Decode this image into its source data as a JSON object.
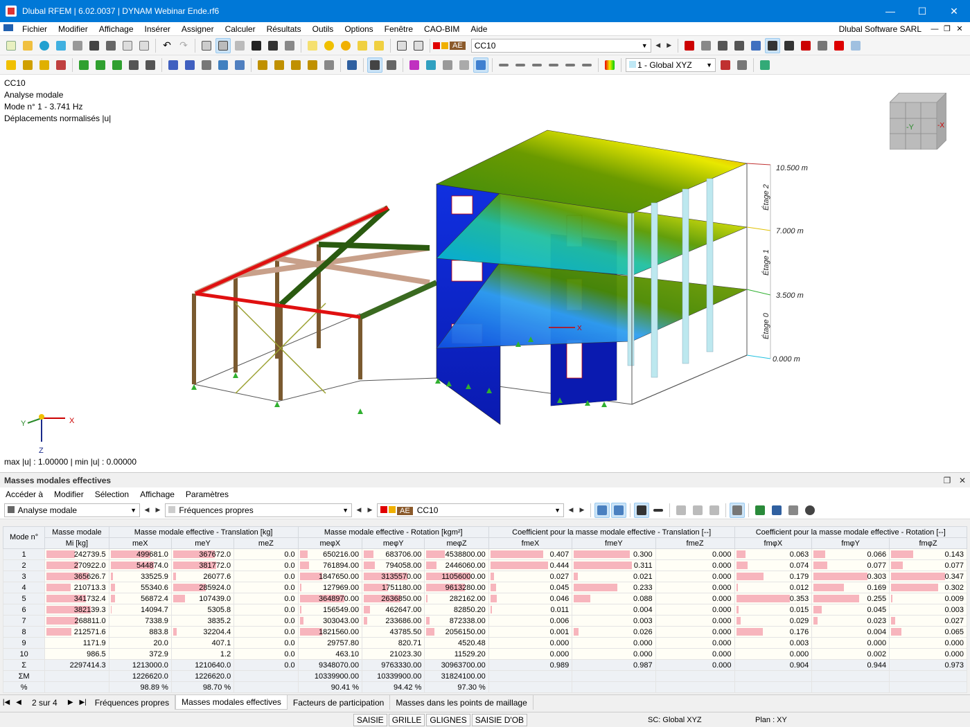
{
  "window": {
    "title": "Dlubal RFEM | 6.02.0037 | DYNAM Webinar Ende.rf6"
  },
  "menu": {
    "items": [
      "Fichier",
      "Modifier",
      "Affichage",
      "Insérer",
      "Assigner",
      "Calculer",
      "Résultats",
      "Outils",
      "Options",
      "Fenêtre",
      "CAO-BIM",
      "Aide"
    ],
    "company": "Dlubal Software SARL"
  },
  "toolbar": {
    "load_tag": "AE",
    "load_case": "CC10",
    "coord_system": "1 - Global XYZ",
    "colors": {
      "swatch1": "#e00000",
      "swatch2": "#f0b000"
    }
  },
  "viewport": {
    "info": [
      "CC10",
      "Analyse modale",
      "Mode n° 1 - 3.741 Hz",
      "Déplacements normalisés |u|"
    ],
    "footer": "max |u| : 1.00000 | min |u| : 0.00000",
    "levels": [
      "10.500 m",
      "7.000 m",
      "3.500 m",
      "0.000 m"
    ],
    "storeys": [
      "Étage 2",
      "Étage 1",
      "Étage 0"
    ],
    "axes": {
      "x": "X",
      "y": "Y",
      "z": "Z"
    },
    "cube": {
      "y": "-Y",
      "x": "-X"
    }
  },
  "panel": {
    "title": "Masses modales effectives",
    "menu": [
      "Accéder à",
      "Modifier",
      "Sélection",
      "Affichage",
      "Paramètres"
    ],
    "combo_analysis": "Analyse modale",
    "combo_type": "Fréquences propres",
    "load_tag": "AE",
    "load_case": "CC10"
  },
  "table": {
    "group_headers": {
      "mode": "Mode n°",
      "mass": "Masse modale",
      "translation": "Masse modale effective - Translation [kg]",
      "rotation": "Masse modale effective - Rotation [kgm²]",
      "coef_translation": "Coefficient pour la masse modale effective - Translation [--]",
      "coef_rotation": "Coefficient pour la masse modale effective - Rotation [--]"
    },
    "columns": [
      "Mi [kg]",
      "meX",
      "meY",
      "meZ",
      "meφX",
      "meφY",
      "meφZ",
      "fmeX",
      "fmeY",
      "fmeZ",
      "fmφX",
      "fmφY",
      "fmφZ"
    ],
    "rows": [
      {
        "mode": "1",
        "vals": [
          "242739.5",
          "499681.0",
          "367672.0",
          "0.0",
          "650216.00",
          "683706.00",
          "4538800.00",
          "0.407",
          "0.300",
          "0.000",
          "0.063",
          "0.066",
          "0.143"
        ]
      },
      {
        "mode": "2",
        "vals": [
          "270922.0",
          "544874.0",
          "381772.0",
          "0.0",
          "761894.00",
          "794058.00",
          "2446060.00",
          "0.444",
          "0.311",
          "0.000",
          "0.074",
          "0.077",
          "0.077"
        ]
      },
      {
        "mode": "3",
        "vals": [
          "365626.7",
          "33525.9",
          "26077.6",
          "0.0",
          "1847650.00",
          "3135570.00",
          "11056000.00",
          "0.027",
          "0.021",
          "0.000",
          "0.179",
          "0.303",
          "0.347"
        ]
      },
      {
        "mode": "4",
        "vals": [
          "210713.3",
          "55340.6",
          "285924.0",
          "0.0",
          "127969.00",
          "1751180.00",
          "9613280.00",
          "0.045",
          "0.233",
          "0.000",
          "0.012",
          "0.169",
          "0.302"
        ]
      },
      {
        "mode": "5",
        "vals": [
          "341732.4",
          "56872.4",
          "107439.0",
          "0.0",
          "3648970.00",
          "2636850.00",
          "282162.00",
          "0.046",
          "0.088",
          "0.000",
          "0.353",
          "0.255",
          "0.009"
        ]
      },
      {
        "mode": "6",
        "vals": [
          "382139.3",
          "14094.7",
          "5305.8",
          "0.0",
          "156549.00",
          "462647.00",
          "82850.20",
          "0.011",
          "0.004",
          "0.000",
          "0.015",
          "0.045",
          "0.003"
        ]
      },
      {
        "mode": "7",
        "vals": [
          "268811.0",
          "7338.9",
          "3835.2",
          "0.0",
          "303043.00",
          "233686.00",
          "872338.00",
          "0.006",
          "0.003",
          "0.000",
          "0.029",
          "0.023",
          "0.027"
        ]
      },
      {
        "mode": "8",
        "vals": [
          "212571.6",
          "883.8",
          "32204.4",
          "0.0",
          "1821560.00",
          "43785.50",
          "2056150.00",
          "0.001",
          "0.026",
          "0.000",
          "0.176",
          "0.004",
          "0.065"
        ]
      },
      {
        "mode": "9",
        "vals": [
          "1171.9",
          "20.0",
          "407.1",
          "0.0",
          "29757.80",
          "820.71",
          "4520.48",
          "0.000",
          "0.000",
          "0.000",
          "0.003",
          "0.000",
          "0.000"
        ]
      },
      {
        "mode": "10",
        "vals": [
          "986.5",
          "372.9",
          "1.2",
          "0.0",
          "463.10",
          "21023.30",
          "11529.20",
          "0.000",
          "0.000",
          "0.000",
          "0.000",
          "0.002",
          "0.000"
        ]
      }
    ],
    "sum_row": {
      "mode": "Σ",
      "vals": [
        "2297414.3",
        "1213000.0",
        "1210640.0",
        "0.0",
        "9348070.00",
        "9763330.00",
        "30963700.00",
        "0.989",
        "0.987",
        "0.000",
        "0.904",
        "0.944",
        "0.973"
      ]
    },
    "summ_row": {
      "mode": "ΣM",
      "vals": [
        "",
        "1226620.0",
        "1226620.0",
        "",
        "10339900.00",
        "10339900.00",
        "31824100.00",
        "",
        "",
        "",
        "",
        "",
        ""
      ]
    },
    "pct_row": {
      "mode": "%",
      "vals": [
        "",
        "98.89 %",
        "98.70 %",
        "",
        "90.41 %",
        "94.42 %",
        "97.30 %",
        "",
        "",
        "",
        "",
        "",
        ""
      ]
    }
  },
  "tabs": {
    "page": "2 sur 4",
    "items": [
      "Fréquences propres",
      "Masses modales effectives",
      "Facteurs de participation",
      "Masses dans les points de maillage"
    ],
    "active": 1
  },
  "status": {
    "buttons": [
      "SAISIE",
      "GRILLE",
      "GLIGNES",
      "SAISIE D'OB"
    ],
    "cs": "SC: Global XYZ",
    "plane": "Plan : XY"
  }
}
